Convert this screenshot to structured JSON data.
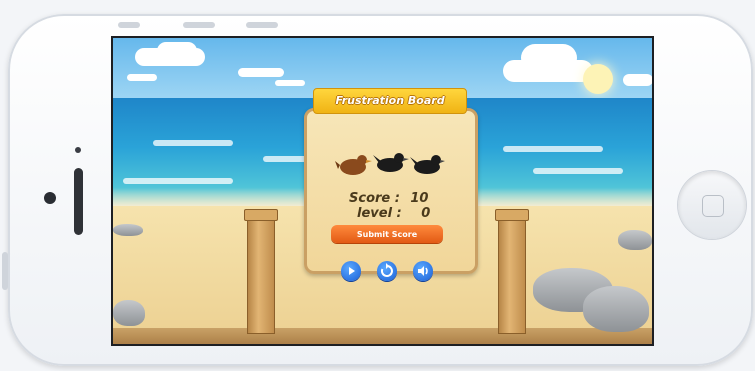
{
  "game": {
    "board_title": "Frustration Board",
    "score_label": "Score :",
    "score_value": "10",
    "level_label": "level :",
    "level_value": "0",
    "submit_label": "Submit Score",
    "controls": [
      "play-icon",
      "replay-icon",
      "sound-icon"
    ],
    "birds": [
      "brown-bird-icon",
      "black-bird-icon",
      "black-bird-icon"
    ]
  },
  "colors": {
    "accent_button": "#e25a14",
    "control_button": "#1a5fd6",
    "ribbon": "#f0b314",
    "board": "#f1d699"
  }
}
